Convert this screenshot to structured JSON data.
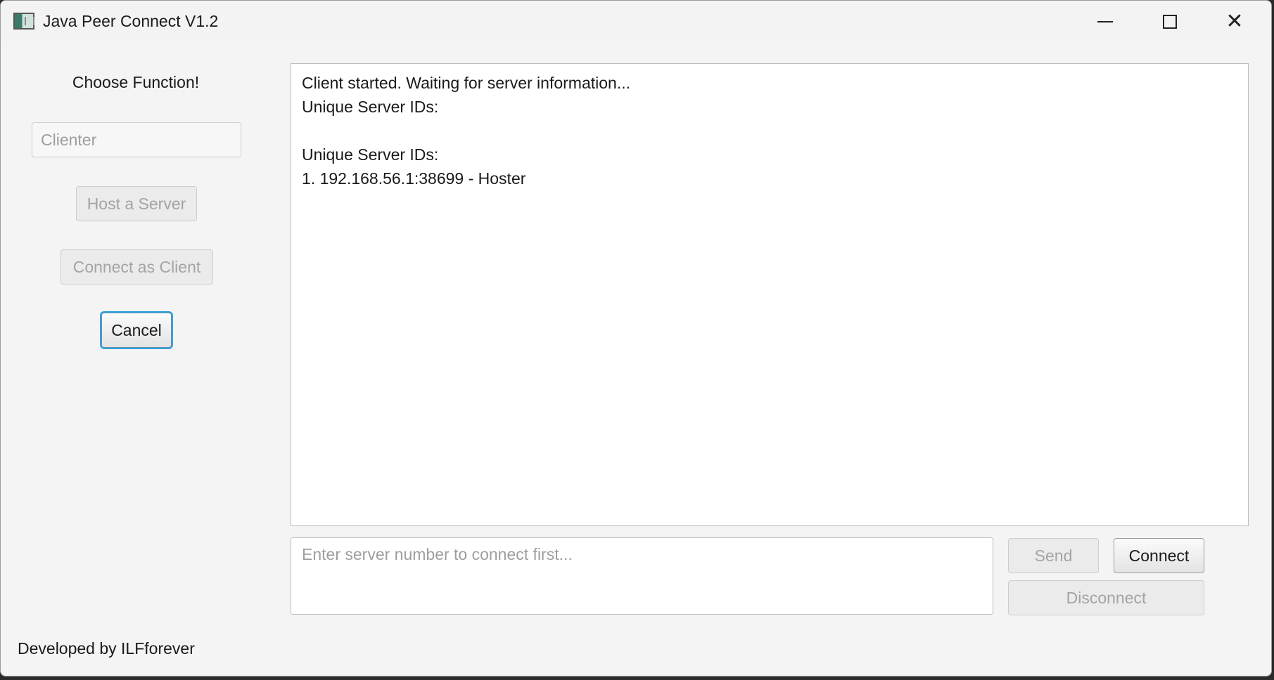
{
  "window": {
    "title": "Java Peer Connect V1.2",
    "icon": "app-icon",
    "controls": {
      "minimize": "minimize-icon",
      "maximize": "maximize-icon",
      "close": "close-icon"
    }
  },
  "left_panel": {
    "heading": "Choose Function!",
    "name_field": {
      "value": "",
      "placeholder": "Clienter"
    },
    "host_button": "Host a Server",
    "client_button": "Connect as Client",
    "cancel_button": "Cancel"
  },
  "log": {
    "lines": [
      "Client started. Waiting for server information...",
      "Unique Server IDs:",
      "",
      "Unique Server IDs:",
      "1. 192.168.56.1:38699 - Hoster"
    ]
  },
  "message": {
    "value": "",
    "placeholder": "Enter server number to connect first..."
  },
  "actions": {
    "send": "Send",
    "connect": "Connect",
    "disconnect": "Disconnect"
  },
  "footer": {
    "credit": "Developed by ILFforever"
  },
  "colors": {
    "focus_ring": "#2aa3e0",
    "window_bg": "#f4f4f4",
    "disabled_text": "#a4a4a4"
  }
}
